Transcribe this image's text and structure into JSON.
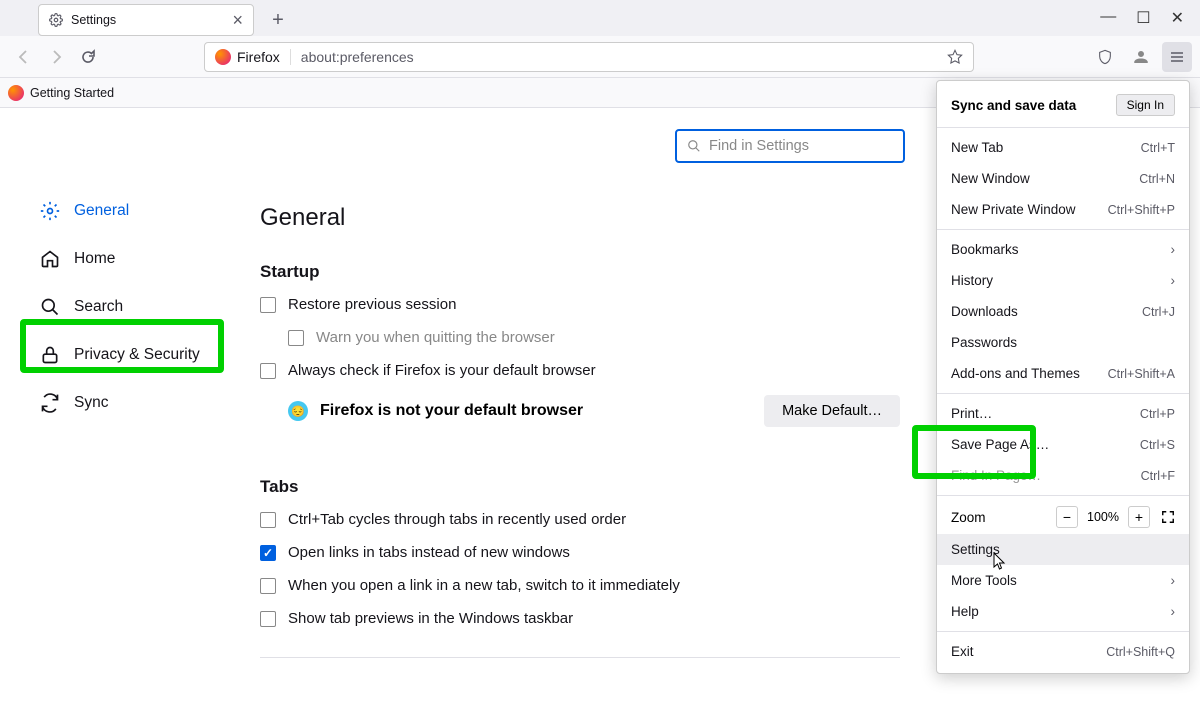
{
  "tab": {
    "title": "Settings"
  },
  "url": {
    "identity": "Firefox",
    "address": "about:preferences"
  },
  "bookmarks": {
    "item0": "Getting Started"
  },
  "sidebar": {
    "general": "General",
    "home": "Home",
    "search": "Search",
    "privacy": "Privacy & Security",
    "sync": "Sync"
  },
  "search": {
    "placeholder": "Find in Settings"
  },
  "page": {
    "h1": "General",
    "startup": "Startup",
    "restore": "Restore previous session",
    "warn": "Warn you when quitting the browser",
    "always": "Always check if Firefox is your default browser",
    "notdefault": "Firefox is not your default browser",
    "makedefault": "Make Default…",
    "tabs": "Tabs",
    "ctrltab": "Ctrl+Tab cycles through tabs in recently used order",
    "openlinks": "Open links in tabs instead of new windows",
    "switchto": "When you open a link in a new tab, switch to it immediately",
    "previews": "Show tab previews in the Windows taskbar"
  },
  "menu": {
    "sync": "Sync and save data",
    "signin": "Sign In",
    "newtab": "New Tab",
    "newtab_s": "Ctrl+T",
    "newwin": "New Window",
    "newwin_s": "Ctrl+N",
    "newpriv": "New Private Window",
    "newpriv_s": "Ctrl+Shift+P",
    "bookmarks": "Bookmarks",
    "history": "History",
    "downloads": "Downloads",
    "downloads_s": "Ctrl+J",
    "passwords": "Passwords",
    "addons": "Add-ons and Themes",
    "addons_s": "Ctrl+Shift+A",
    "print": "Print…",
    "print_s": "Ctrl+P",
    "save": "Save Page As…",
    "save_s": "Ctrl+S",
    "find": "Find In Page…",
    "find_s": "Ctrl+F",
    "zoom": "Zoom",
    "zoom_v": "100%",
    "settings": "Settings",
    "moretools": "More Tools",
    "help": "Help",
    "exit": "Exit",
    "exit_s": "Ctrl+Shift+Q"
  },
  "window": {
    "min": "—",
    "max": "☐",
    "close": "✕"
  }
}
